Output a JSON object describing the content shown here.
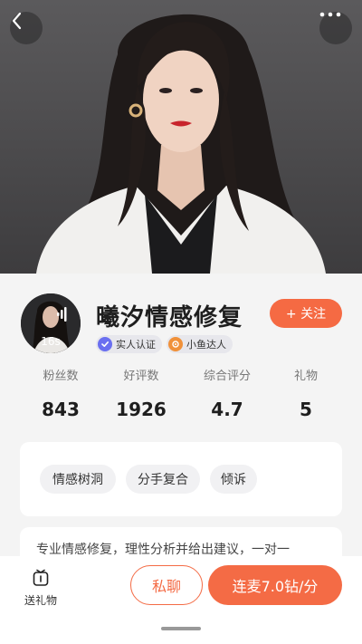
{
  "header": {
    "back_icon": "chevron-left-icon",
    "more_icon": "more-dots-icon"
  },
  "profile": {
    "name": "曦汐情感修复",
    "avatar_duration": "16s",
    "badges": [
      {
        "label": "实人认证",
        "icon": "verified-check-icon",
        "color": "#6a6ff0"
      },
      {
        "label": "小鱼达人",
        "icon": "fish-expert-icon",
        "color": "#f0913a"
      }
    ],
    "follow_label": "+ 关注",
    "stats": [
      {
        "label": "粉丝数",
        "value": "843"
      },
      {
        "label": "好评数",
        "value": "1926"
      },
      {
        "label": "综合评分",
        "value": "4.7"
      },
      {
        "label": "礼物",
        "value": "5"
      }
    ]
  },
  "tags": [
    "情感树洞",
    "分手复合",
    "倾诉"
  ],
  "description": "专业情感修复，理性分析并给出建议，一对一",
  "bottom_bar": {
    "gift_label": "送礼物",
    "chat_label": "私聊",
    "call_label": "连麦7.0钻/分"
  },
  "colors": {
    "accent": "#f46b45",
    "page_bg": "#f4f4f4",
    "card_bg": "#ffffff"
  }
}
